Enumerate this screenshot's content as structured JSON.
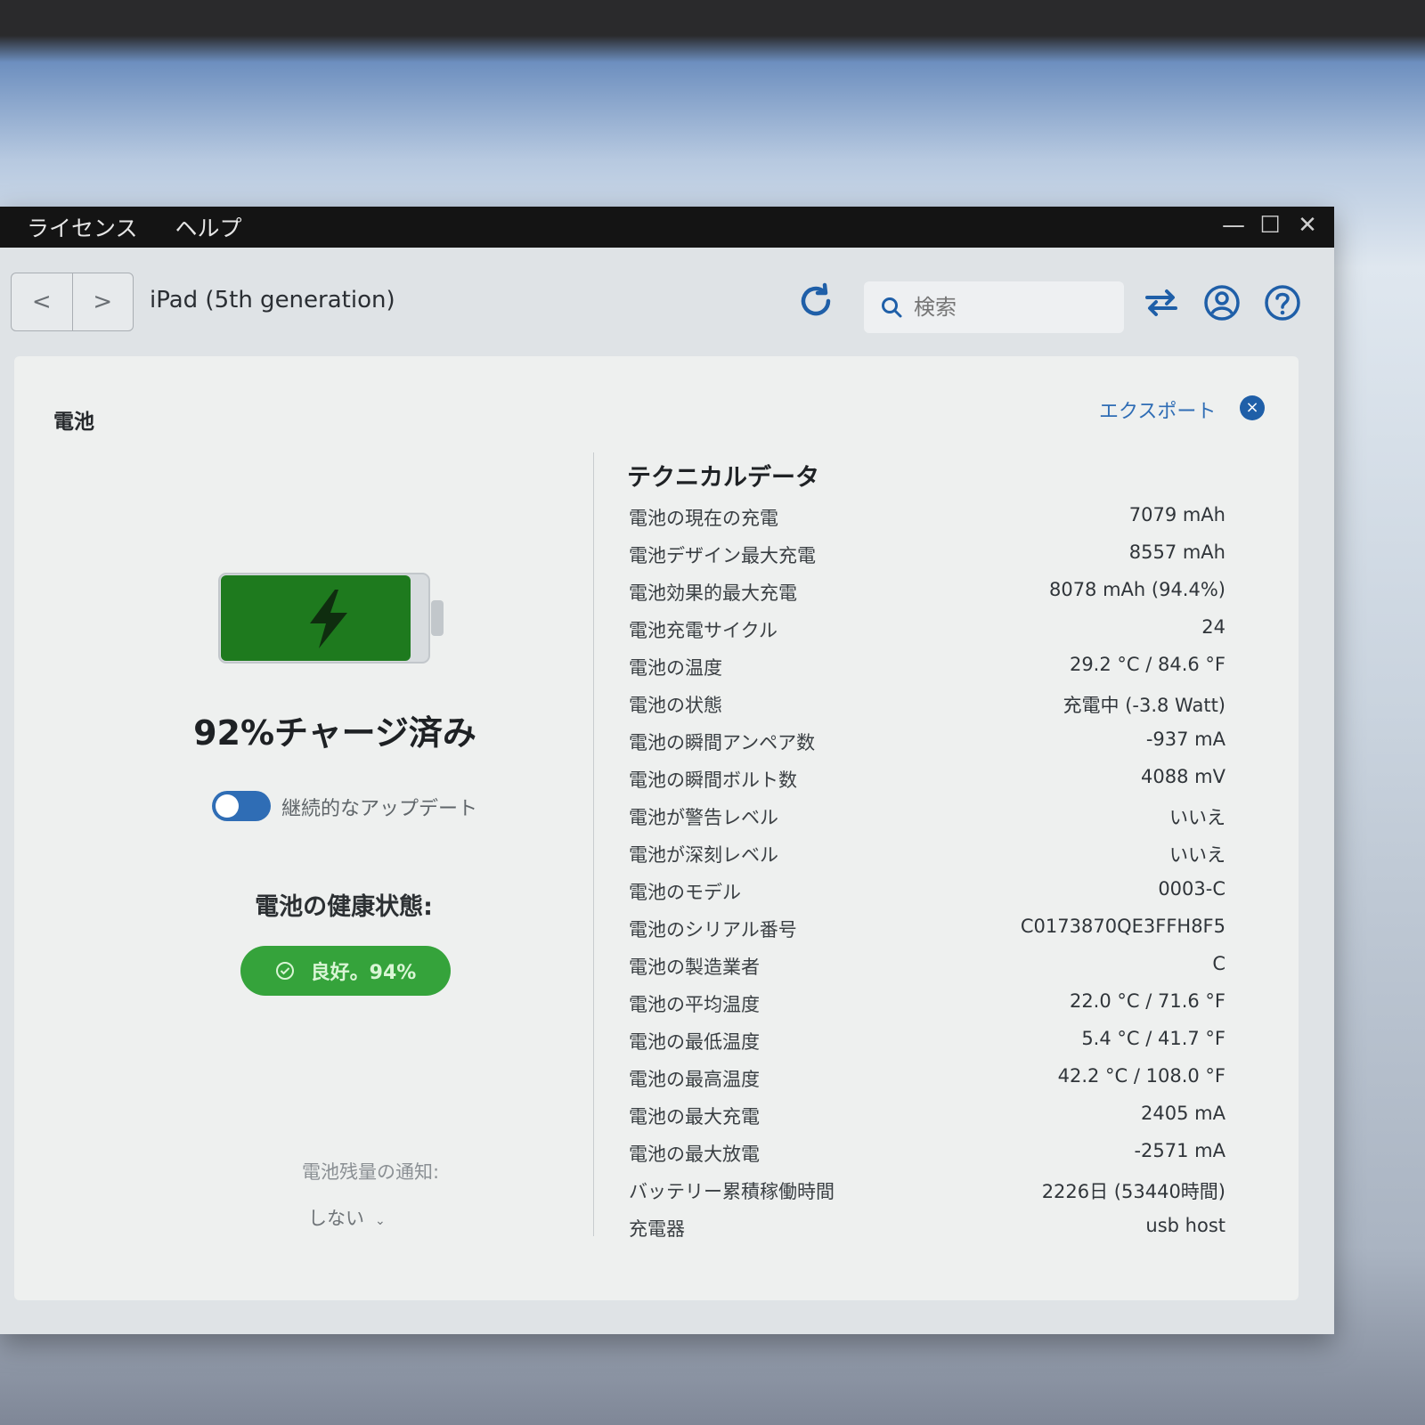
{
  "menu": {
    "items": [
      "ライセンス",
      "ヘルプ"
    ]
  },
  "window_controls": {
    "minimize": "—",
    "maximize": "☐",
    "close": "✕"
  },
  "toolbar": {
    "back": "<",
    "forward": ">",
    "device_title": "iPad (5th generation)",
    "search_placeholder": "検索"
  },
  "panel": {
    "title": "電池",
    "export_label": "エクスポート",
    "close_label": "×"
  },
  "battery": {
    "charge_level": 0.92,
    "charge_text": "92%チャージ済み",
    "toggle_label": "継続的なアップデート",
    "toggle_on": true,
    "health_heading": "電池の健康状態:",
    "health_badge": "良好。94%",
    "notify_label": "電池残量の通知:",
    "notify_value": "しない"
  },
  "colors": {
    "accent": "#2f6db5",
    "battery_green": "#1e7a1e",
    "health_green": "#35a33b"
  },
  "technical": {
    "title": "テクニカルデータ",
    "rows": [
      {
        "label": "電池の現在の充電",
        "value": "7079 mAh"
      },
      {
        "label": "電池デザイン最大充電",
        "value": "8557 mAh"
      },
      {
        "label": "電池効果的最大充電",
        "value": "8078 mAh (94.4%)"
      },
      {
        "label": "電池充電サイクル",
        "value": "24"
      },
      {
        "label": "電池の温度",
        "value": "29.2 °C / 84.6 °F"
      },
      {
        "label": "電池の状態",
        "value": "充電中 (-3.8 Watt)"
      },
      {
        "label": "電池の瞬間アンペア数",
        "value": "-937 mA"
      },
      {
        "label": "電池の瞬間ボルト数",
        "value": "4088 mV"
      },
      {
        "label": "電池が警告レベル",
        "value": "いいえ"
      },
      {
        "label": "電池が深刻レベル",
        "value": "いいえ"
      },
      {
        "label": "電池のモデル",
        "value": "0003-C"
      },
      {
        "label": "電池のシリアル番号",
        "value": "C0173870QE3FFH8F5"
      },
      {
        "label": "電池の製造業者",
        "value": "C"
      },
      {
        "label": "電池の平均温度",
        "value": "22.0 °C / 71.6 °F"
      },
      {
        "label": "電池の最低温度",
        "value": "5.4 °C / 41.7 °F"
      },
      {
        "label": "電池の最高温度",
        "value": "42.2 °C / 108.0 °F"
      },
      {
        "label": "電池の最大充電",
        "value": "2405 mA"
      },
      {
        "label": "電池の最大放電",
        "value": "-2571 mA"
      },
      {
        "label": "バッテリー累積稼働時間",
        "value": "2226日 (53440時間)"
      },
      {
        "label": "充電器",
        "value": "usb host"
      }
    ]
  }
}
